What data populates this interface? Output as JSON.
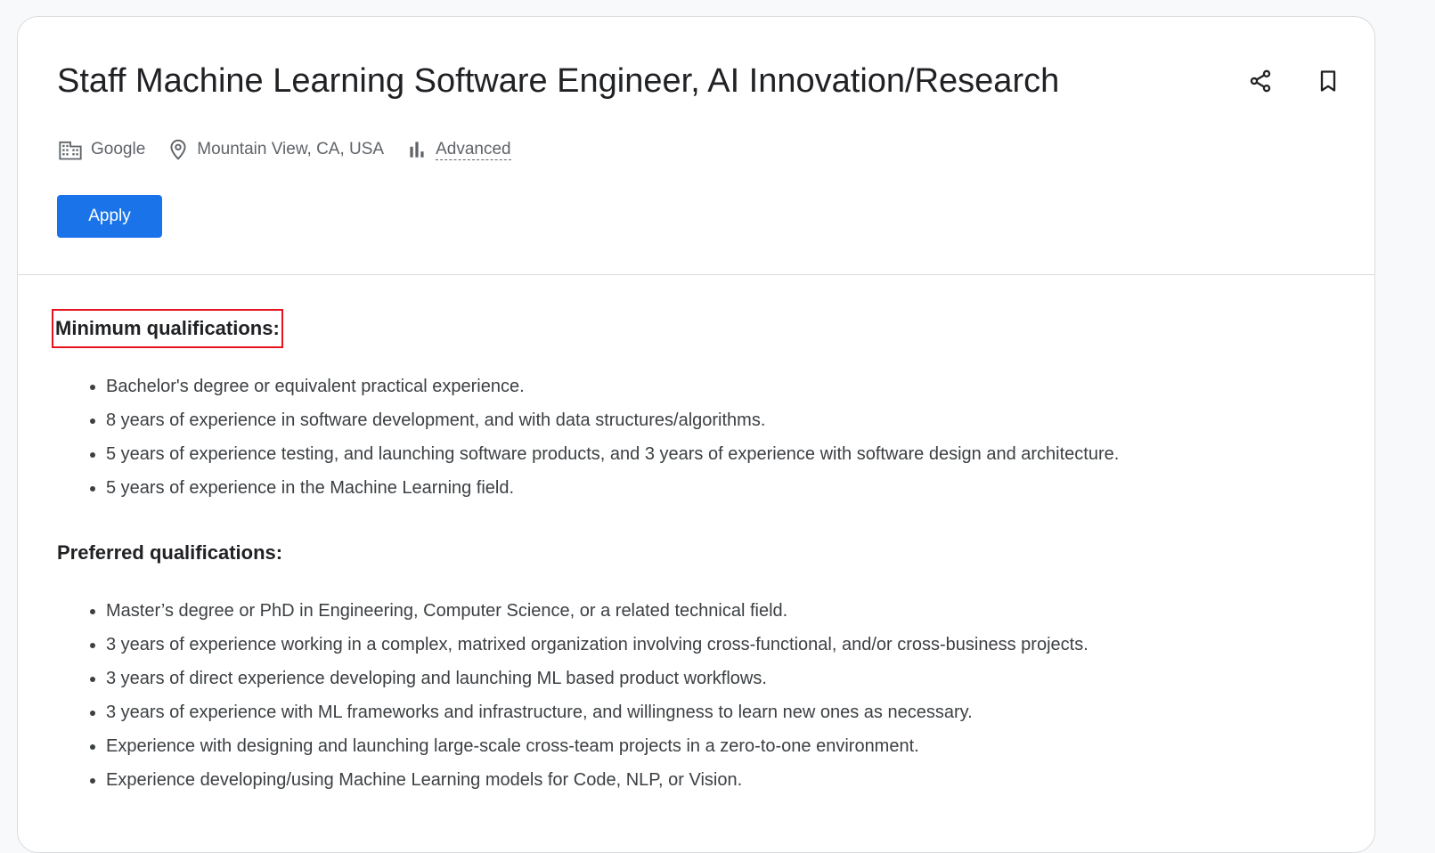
{
  "job": {
    "title": "Staff Machine Learning Software Engineer, AI Innovation/Research",
    "company": "Google",
    "location": "Mountain View, CA, USA",
    "level": "Advanced"
  },
  "actions": {
    "apply_label": "Apply",
    "share_icon": "share-icon",
    "bookmark_icon": "bookmark-icon"
  },
  "minimum_qualifications": {
    "heading": "Minimum qualifications:",
    "items": [
      "Bachelor's degree or equivalent practical experience.",
      "8 years of experience in software development, and with data structures/algorithms.",
      "5 years of experience testing, and launching software products, and 3 years of experience with software design and architecture.",
      "5 years of experience in the Machine Learning field."
    ]
  },
  "preferred_qualifications": {
    "heading": "Preferred qualifications:",
    "items": [
      "Master’s degree or PhD in Engineering, Computer Science, or a related technical field.",
      "3 years of experience working in a complex, matrixed organization involving cross-functional, and/or cross-business projects.",
      "3 years of direct experience developing and launching ML based product workflows.",
      "3 years of experience with ML frameworks and infrastructure, and willingness to learn new ones as necessary.",
      "Experience with designing and launching large-scale cross-team projects in a zero-to-one environment.",
      "Experience developing/using Machine Learning models for Code, NLP, or Vision."
    ]
  },
  "colors": {
    "accent": "#1a73e8",
    "highlight_box": "#e8131e",
    "text_primary": "#202124",
    "text_secondary": "#5f6368"
  }
}
